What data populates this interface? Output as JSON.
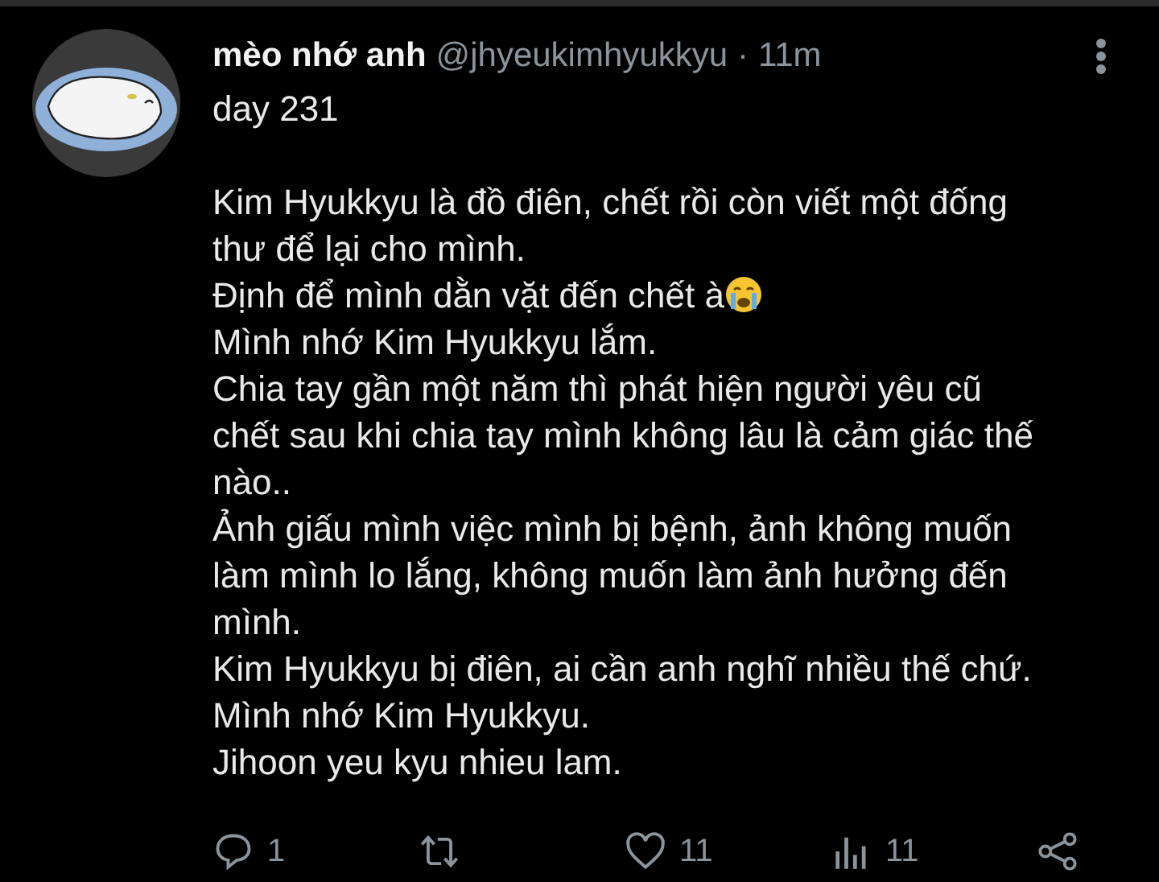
{
  "tweet": {
    "display_name": "mèo nhớ anh",
    "handle": "@jhyeukimhyukkyu",
    "separator": "·",
    "time": "11m",
    "first_line": "day 231",
    "paragraphs": [
      {
        "text": "Kim Hyukkyu là đồ điên, chết rồi còn viết một đống thư để lại cho mình.",
        "emoji": false
      },
      {
        "text": "Định để mình dằn vặt đến chết à",
        "emoji": true
      },
      {
        "text": "Mình nhớ Kim Hyukkyu lắm.",
        "emoji": false
      },
      {
        "text": "Chia tay gần một năm thì phát hiện người yêu cũ chết sau khi chia tay mình không lâu là cảm giác thế nào..",
        "emoji": false
      },
      {
        "text": "Ảnh giấu mình việc mình bị bệnh, ảnh không muốn làm mình lo lắng, không muốn làm ảnh hưởng đến mình.",
        "emoji": false
      },
      {
        "text": "Kim Hyukkyu bị điên, ai cần anh nghĩ nhiều thế chứ.",
        "emoji": false
      },
      {
        "text": "Mình nhớ Kim Hyukkyu.",
        "emoji": false
      },
      {
        "text": "Jihoon yeu kyu nhieu lam.",
        "emoji": false
      }
    ],
    "actions": [
      {
        "kind": "reply",
        "count": "1"
      },
      {
        "kind": "retweet"
      },
      {
        "kind": "like",
        "count": "11"
      },
      {
        "kind": "views",
        "count": "11"
      },
      {
        "kind": "share"
      }
    ]
  }
}
